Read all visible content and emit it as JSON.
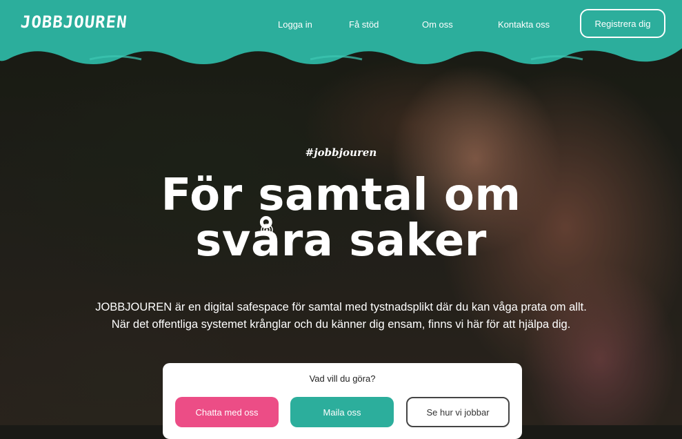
{
  "brand": {
    "logo_text": "JOBBJOUREN",
    "accent_color": "#2cae9c",
    "pink_color": "#ec4d86"
  },
  "nav": {
    "items": [
      {
        "label": "Logga in"
      },
      {
        "label": "Få stöd"
      },
      {
        "label": "Om oss"
      },
      {
        "label": "Kontakta oss"
      }
    ],
    "register_label": "Registrera dig"
  },
  "hero": {
    "hashtag": "#jobbjouren",
    "headline_line1": "För samtal om",
    "headline_line2": "svåra saker",
    "description_line1": "JOBBJOUREN är en digital safespace för samtal med tystnadsplikt där du kan våga prata om allt.",
    "description_line2": "När det offentliga systemet krånglar och du känner dig ensam, finns vi här för att hjälpa dig."
  },
  "actions": {
    "title": "Vad vill du göra?",
    "chat_label": "Chatta med oss",
    "mail_label": "Maila oss",
    "how_label": "Se hur vi jobbar"
  }
}
